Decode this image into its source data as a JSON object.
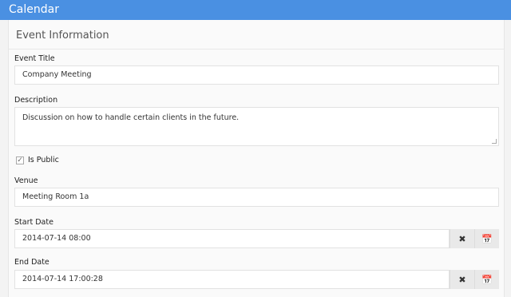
{
  "app": {
    "title": "Calendar"
  },
  "form": {
    "section_title": "Event Information",
    "event_title": {
      "label": "Event Title",
      "value": "Company Meeting"
    },
    "description": {
      "label": "Description",
      "value": "Discussion on how to handle certain clients in the future."
    },
    "is_public": {
      "label": "Is Public",
      "checked": true,
      "mark": "✓"
    },
    "venue": {
      "label": "Venue",
      "value": "Meeting Room 1a"
    },
    "start_date": {
      "label": "Start Date",
      "value": "2014-07-14 08:00"
    },
    "end_date": {
      "label": "End Date",
      "value": "2014-07-14 17:00:28"
    },
    "buttons": {
      "clear": "✖",
      "calendar": "📅"
    }
  },
  "icons": {
    "clear": "close-icon",
    "calendar": "calendar-icon"
  },
  "colors": {
    "titlebar": "#4a90e2"
  }
}
